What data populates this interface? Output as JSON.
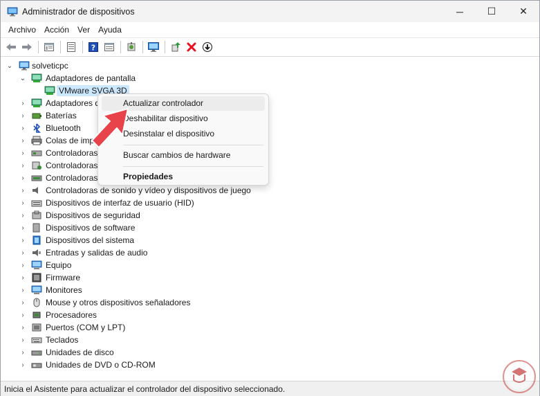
{
  "window": {
    "title": "Administrador de dispositivos",
    "controls": {
      "minimize": "─",
      "maximize": "☐",
      "close": "✕"
    }
  },
  "menu": [
    "Archivo",
    "Acción",
    "Ver",
    "Ayuda"
  ],
  "toolbar": {
    "buttons": [
      "back-icon",
      "forward-icon",
      "properties-view-icon",
      "list-icon",
      "help-icon",
      "details-icon",
      "driver-icon",
      "scan-monitor-icon",
      "add-driver-icon",
      "remove-icon",
      "download-icon"
    ],
    "colors": {
      "remove": "#e81123",
      "help": "#1f4fb8"
    }
  },
  "tree": {
    "root": "solveticpc",
    "expanded_category": "Adaptadores de pantalla",
    "selected_device": "VMware SVGA 3D",
    "categories": [
      "Adaptadores d",
      "Baterías",
      "Bluetooth",
      "Colas de impr",
      "Controladoras",
      "Controladoras",
      "Controladoras",
      "Controladoras de sonido y vídeo y dispositivos de juego",
      "Dispositivos de interfaz de usuario (HID)",
      "Dispositivos de seguridad",
      "Dispositivos de software",
      "Dispositivos del sistema",
      "Entradas y salidas de audio",
      "Equipo",
      "Firmware",
      "Monitores",
      "Mouse y otros dispositivos señaladores",
      "Procesadores",
      "Puertos (COM y LPT)",
      "Teclados",
      "Unidades de disco",
      "Unidades de DVD o CD-ROM"
    ]
  },
  "context_menu": {
    "items": [
      {
        "label": "Actualizar controlador",
        "hover": true
      },
      {
        "label": "Deshabilitar dispositivo"
      },
      {
        "label": "Desinstalar el dispositivo"
      },
      {
        "label": "Buscar cambios de hardware"
      },
      {
        "label": "Propiedades",
        "bold": true
      }
    ]
  },
  "status": "Inicia el Asistente para actualizar el controlador del dispositivo seleccionado.",
  "accent": {
    "selection": "#cce8ff",
    "arrow": "#e8434a"
  }
}
